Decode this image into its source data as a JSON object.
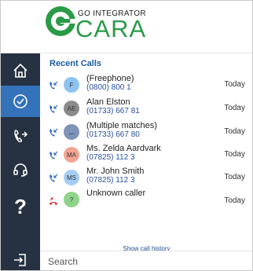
{
  "brand": {
    "small": "GO INTEGRATOR",
    "large": "CARA",
    "color": "#2a9a47"
  },
  "sidebar": {
    "items": [
      {
        "name": "home",
        "icon": "home-icon"
      },
      {
        "name": "recent-calls",
        "icon": "clock-icon",
        "active": true
      },
      {
        "name": "call-forward",
        "icon": "phone-forward-icon"
      },
      {
        "name": "headset",
        "icon": "headset-icon"
      },
      {
        "name": "help",
        "icon": "help-icon",
        "label": "?"
      },
      {
        "name": "sign-out",
        "icon": "sign-out-icon"
      }
    ],
    "bg": "#263241",
    "active_bg": "#3472b9"
  },
  "recent": {
    "title": "Recent Calls",
    "calls": [
      {
        "name": "(Freephone)",
        "number": "(0800) 800 1",
        "when": "Today",
        "initials": "F",
        "avatar_color": "#8ec3f0",
        "status": "incoming"
      },
      {
        "name": "Alan Elston",
        "number": "(01733) 667 81",
        "when": "Today",
        "initials": "AE",
        "avatar_color": "#8b8b8b",
        "status": "incoming"
      },
      {
        "name": "(Multiple matches)",
        "number": "(01733) 667 80",
        "when": "Today",
        "initials": "...",
        "avatar_color": "#7e93b8",
        "status": "incoming"
      },
      {
        "name": "Ms. Zelda Aardvark",
        "number": "(07825) 112 3",
        "when": "Today",
        "initials": "MA",
        "avatar_color": "#f3a595",
        "status": "incoming"
      },
      {
        "name": "Mr. John Smith",
        "number": "(07825) 112 3",
        "when": "Today",
        "initials": "MS",
        "avatar_color": "#a6cdf3",
        "status": "incoming"
      },
      {
        "name": "Unknown caller",
        "number": "",
        "when": "Today",
        "initials": "?",
        "avatar_color": "#8fd48a",
        "status": "missed"
      }
    ],
    "history_link": "Show call history"
  },
  "search": {
    "placeholder": "Search"
  }
}
